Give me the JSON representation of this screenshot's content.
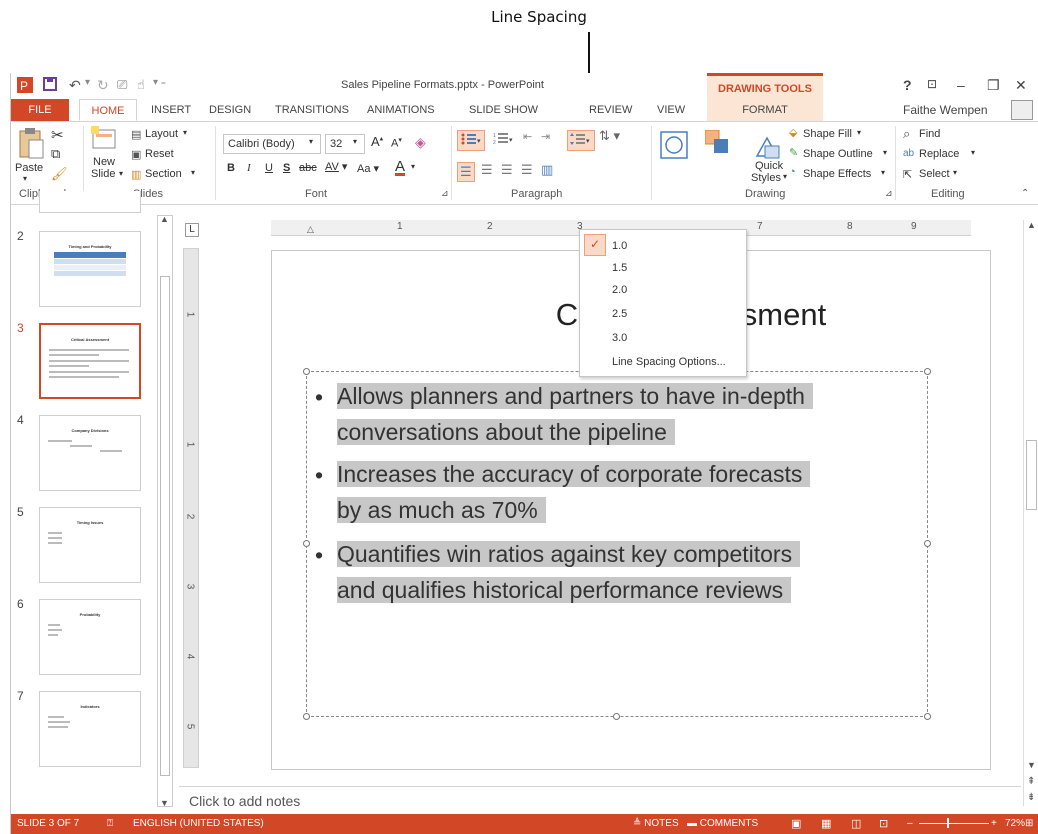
{
  "callout": {
    "label": "Line Spacing"
  },
  "window": {
    "title": "Sales Pipeline Formats.pptx - PowerPoint",
    "context_tab_group": "DRAWING TOOLS",
    "user": "Faithe Wempen",
    "help": "?",
    "minimize": "–",
    "restore": "❐",
    "close": "✕"
  },
  "tabs": [
    "FILE",
    "HOME",
    "INSERT",
    "DESIGN",
    "TRANSITIONS",
    "ANIMATIONS",
    "SLIDE SHOW",
    "REVIEW",
    "VIEW",
    "FORMAT"
  ],
  "ribbon": {
    "clipboard": {
      "label": "Clipboard",
      "paste": "Paste"
    },
    "slides": {
      "label": "Slides",
      "new_slide_1": "New",
      "new_slide_2": "Slide",
      "layout": "Layout",
      "reset": "Reset",
      "section": "Section"
    },
    "font": {
      "label": "Font",
      "name": "Calibri (Body)",
      "size": "32",
      "abc": "abc",
      "aa": "Aa"
    },
    "paragraph": {
      "label": "Paragraph"
    },
    "drawing": {
      "label": "Drawing",
      "quick_styles_1": "Quick",
      "quick_styles_2": "Styles",
      "shape_fill": "Shape Fill",
      "shape_outline": "Shape Outline",
      "shape_effects": "Shape Effects"
    },
    "editing": {
      "label": "Editing",
      "find": "Find",
      "replace": "Replace",
      "select": "Select"
    }
  },
  "line_spacing_menu": {
    "selected": "1.0",
    "items": [
      "1.0",
      "1.5",
      "2.0",
      "2.5",
      "3.0"
    ],
    "options": "Line Spacing Options..."
  },
  "thumbnails": [
    {
      "num": "2",
      "title": "Timing and Probability"
    },
    {
      "num": "3",
      "title": "Critical Assessment"
    },
    {
      "num": "4",
      "title": "Company Divisions"
    },
    {
      "num": "5",
      "title": "Timing Issues"
    },
    {
      "num": "6",
      "title": "Probability"
    },
    {
      "num": "7",
      "title": "Indicators"
    }
  ],
  "slide": {
    "title": "Critical Assessment",
    "bullets": [
      [
        "Allows planners and partners to have in-depth",
        "conversations about the pipeline"
      ],
      [
        "Increases the accuracy of corporate forecasts",
        "by as much as 70%"
      ],
      [
        "Quantifies win ratios against key competitors",
        "and qualifies historical performance reviews"
      ]
    ]
  },
  "notes_placeholder": "Click to add notes",
  "status": {
    "slide": "SLIDE 3 OF 7",
    "language": "ENGLISH (UNITED STATES)",
    "notes": "NOTES",
    "comments": "COMMENTS",
    "zoom": "72%"
  },
  "colors": {
    "accent": "#d24726",
    "context": "#fbe6d6",
    "highlight": "#c7c7c7"
  }
}
